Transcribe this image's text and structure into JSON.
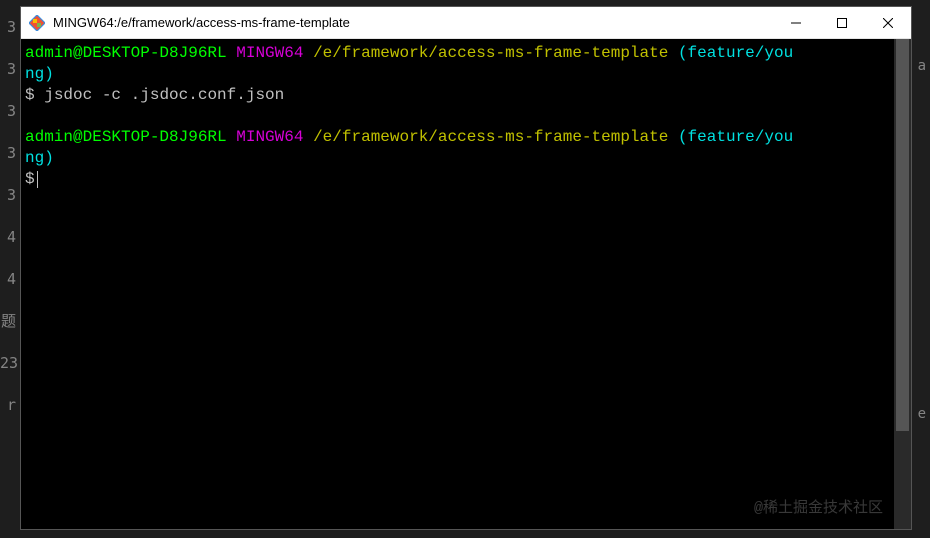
{
  "window": {
    "title": "MINGW64:/e/framework/access-ms-frame-template"
  },
  "gutter": {
    "lines": [
      "3",
      "3",
      "3",
      "3",
      "3",
      "4",
      "4",
      "题",
      "",
      "23",
      "r"
    ]
  },
  "prompt1": {
    "user": "admin@DESKTOP-D8J96RL",
    "env": "MINGW64",
    "path": "/e/framework/access-ms-frame-template",
    "branch_open": "(feature/you",
    "branch_close": "ng)",
    "symbol": "$",
    "command": "jsdoc -c .jsdoc.conf.json"
  },
  "prompt2": {
    "user": "admin@DESKTOP-D8J96RL",
    "env": "MINGW64",
    "path": "/e/framework/access-ms-frame-template",
    "branch_open": "(feature/you",
    "branch_close": "ng)",
    "symbol": "$"
  },
  "watermark": "@稀土掘金技术社区",
  "bg_hints": {
    "e": "e",
    "a": "a"
  }
}
